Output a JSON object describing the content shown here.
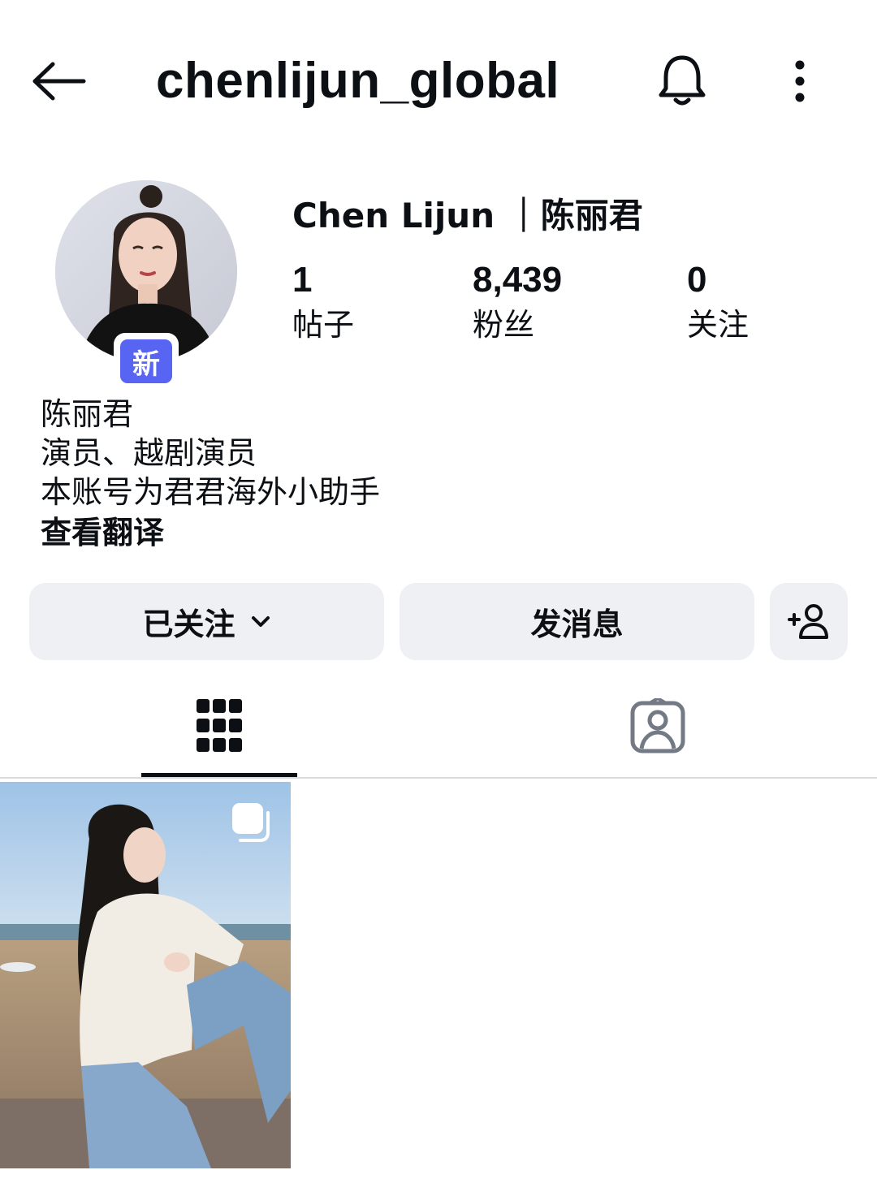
{
  "header": {
    "username": "chenlijun_global",
    "back_icon": "back-arrow-icon",
    "bell_icon": "bell-icon",
    "more_icon": "more-vertical-icon"
  },
  "profile": {
    "full_name": "Chen Lijun ｜陈丽君",
    "new_badge": "新",
    "stats": {
      "posts": {
        "value": "1",
        "label": "帖子"
      },
      "followers": {
        "value": "8,439",
        "label": "粉丝"
      },
      "following": {
        "value": "0",
        "label": "关注"
      }
    },
    "bio": {
      "line1": "陈丽君",
      "line2": "演员、越剧演员",
      "line3": "本账号为君君海外小助手",
      "translate": "查看翻译"
    }
  },
  "actions": {
    "following_label": "已关注",
    "message_label": "发消息",
    "add_user_icon": "add-user-icon"
  },
  "tabs": {
    "grid_icon": "grid-icon",
    "tagged_icon": "tagged-person-icon",
    "active": "grid"
  },
  "posts": [
    {
      "type": "carousel",
      "icon": "multiple-images-icon"
    }
  ],
  "colors": {
    "accent_badge": "#5865f2",
    "button_bg": "#eff0f4",
    "text": "#0c1014",
    "divider": "#dbdbdb"
  }
}
